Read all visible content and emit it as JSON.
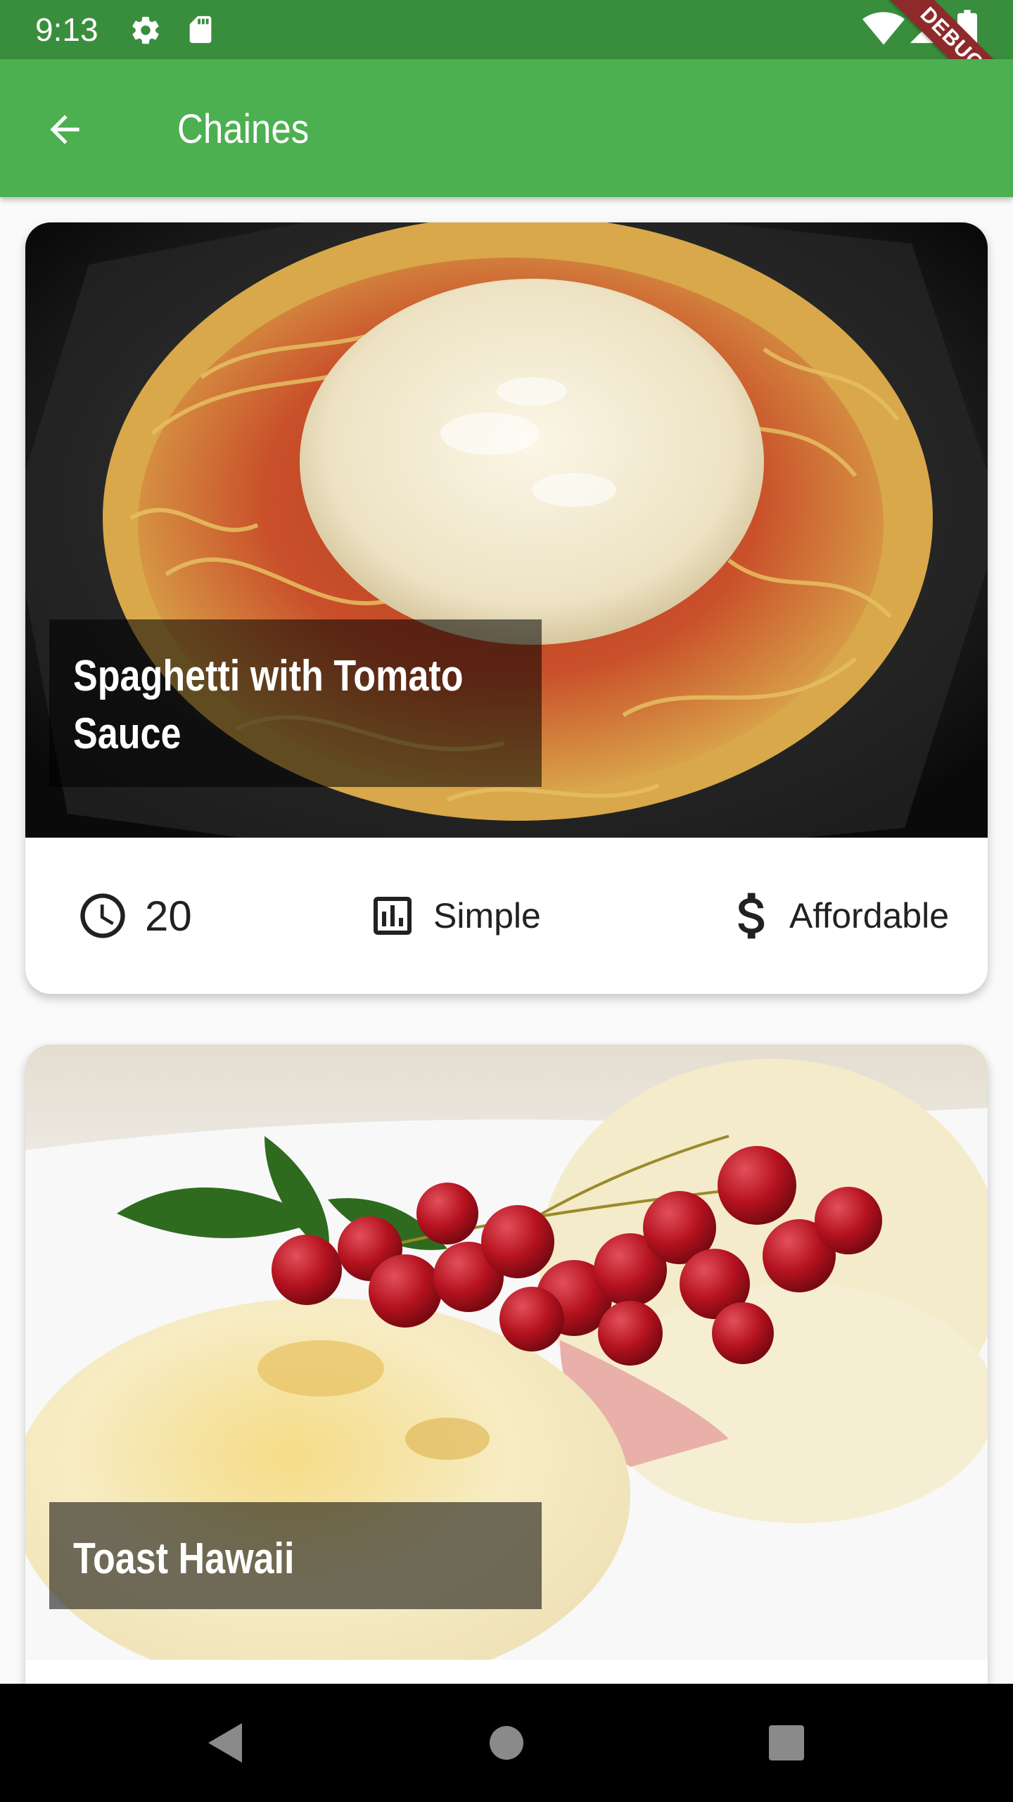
{
  "status_bar": {
    "time": "9:13",
    "icons": [
      "settings-icon",
      "sd-card-icon",
      "wifi-icon",
      "signal-icon",
      "battery-icon"
    ],
    "debug_label": "DEBUG"
  },
  "app_bar": {
    "title": "Chaines",
    "back_icon": "arrow-back-icon"
  },
  "meals": [
    {
      "title": "Spaghetti with Tomato Sauce",
      "duration": "20",
      "complexity": "Simple",
      "affordability": "Affordable"
    },
    {
      "title": "Toast Hawaii"
    }
  ],
  "nav_bar": {
    "buttons": [
      "back-triangle-icon",
      "home-circle-icon",
      "recents-square-icon"
    ]
  },
  "colors": {
    "status_bar": "#388e3c",
    "app_bar": "#4caf50",
    "debug_banner": "#8e2a2a",
    "background": "#fafafa"
  }
}
